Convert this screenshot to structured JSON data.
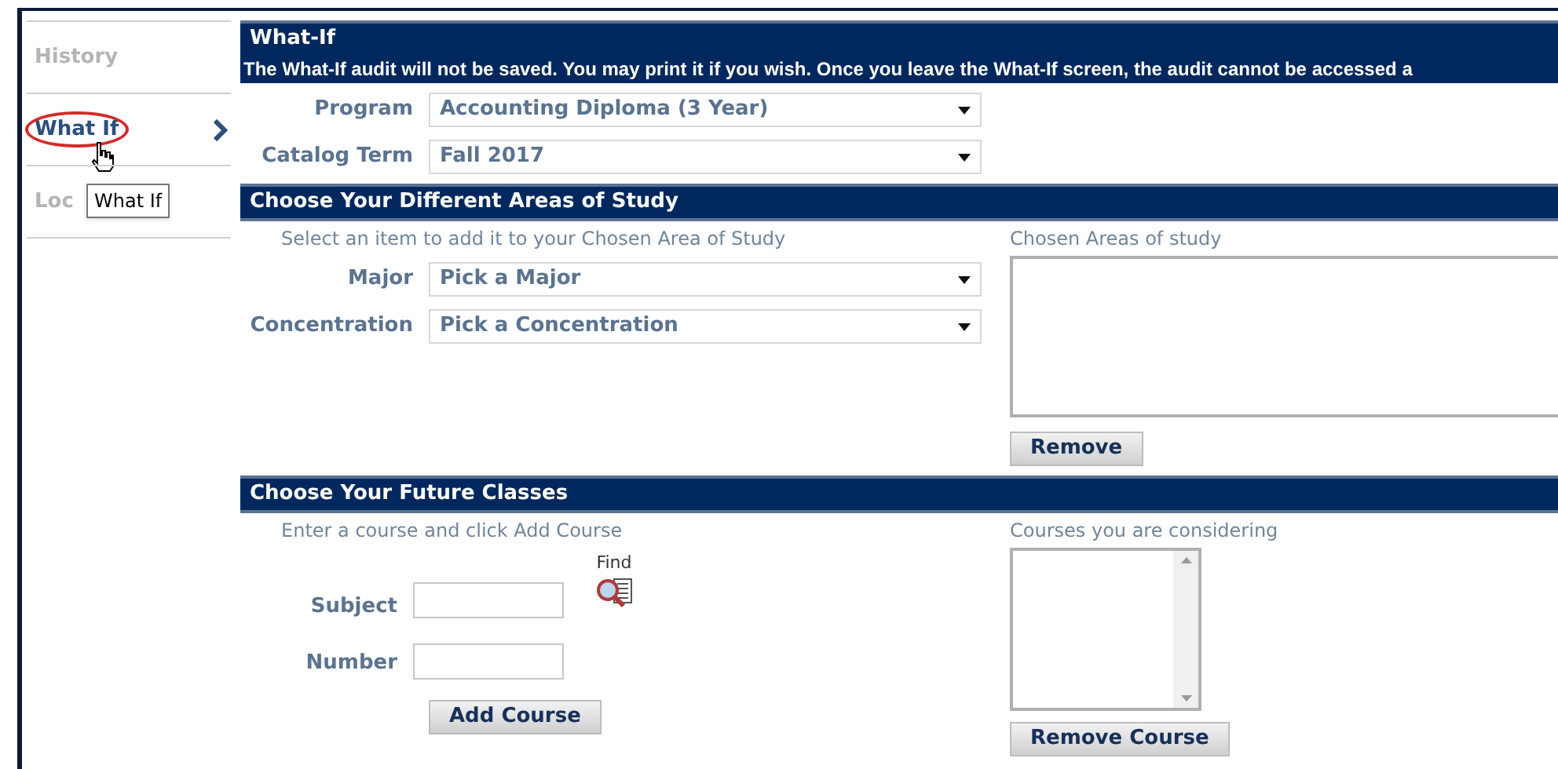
{
  "sidebar": {
    "items": [
      {
        "label": "History",
        "selected": false
      },
      {
        "label": "What If",
        "selected": true
      },
      {
        "label": "Loc",
        "selected": false
      }
    ],
    "tooltip": "What If"
  },
  "whatif": {
    "title": "What-If",
    "notice": "The What-If audit will not be saved. You may print it if you wish. Once you leave the What-If screen, the audit cannot be accessed a",
    "fields": [
      {
        "label": "Program",
        "value": "Accounting Diploma (3 Year)"
      },
      {
        "label": "Catalog Term",
        "value": "Fall 2017"
      }
    ]
  },
  "areas": {
    "title": "Choose Your Different Areas of Study",
    "hint": "Select an item to add it to your Chosen Area of Study",
    "fields": [
      {
        "label": "Major",
        "value": "Pick a Major"
      },
      {
        "label": "Concentration",
        "value": "Pick a Concentration"
      }
    ],
    "chosen_label": "Chosen Areas of study",
    "remove_button": "Remove"
  },
  "classes": {
    "title": "Choose Your Future Classes",
    "hint": "Enter a course and click Add Course",
    "subject_label": "Subject",
    "number_label": "Number",
    "find_label": "Find",
    "add_button": "Add Course",
    "considering_label": "Courses you are considering",
    "remove_button": "Remove Course"
  }
}
